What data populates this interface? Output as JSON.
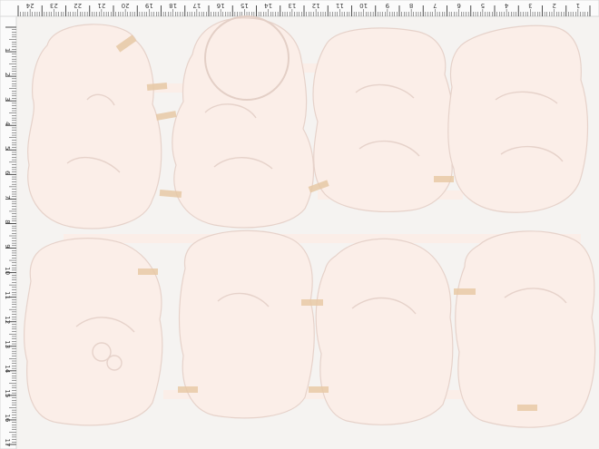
{
  "scene": {
    "description_tag": "photo-scan",
    "colors": {
      "background": "#f5f3f1",
      "paper": "#fbeee8",
      "paper_shadow": "#e9d7cf",
      "ruler": "#fbfbfb",
      "ruler_ink": "#3a3a3a",
      "tape": "#e7c9a6"
    }
  },
  "top_ruler": {
    "labels": [
      "24",
      "23",
      "22",
      "21",
      "20",
      "19",
      "18",
      "17",
      "16",
      "15",
      "14",
      "13",
      "12",
      "11",
      "10",
      "9",
      "8",
      "7",
      "6",
      "5",
      "4",
      "3",
      "2",
      "1"
    ]
  },
  "left_ruler": {
    "labels": [
      "1",
      "2",
      "3",
      "4",
      "5",
      "6",
      "7",
      "8",
      "9",
      "10",
      "11",
      "12",
      "13",
      "14",
      "15",
      "16",
      "17"
    ]
  }
}
